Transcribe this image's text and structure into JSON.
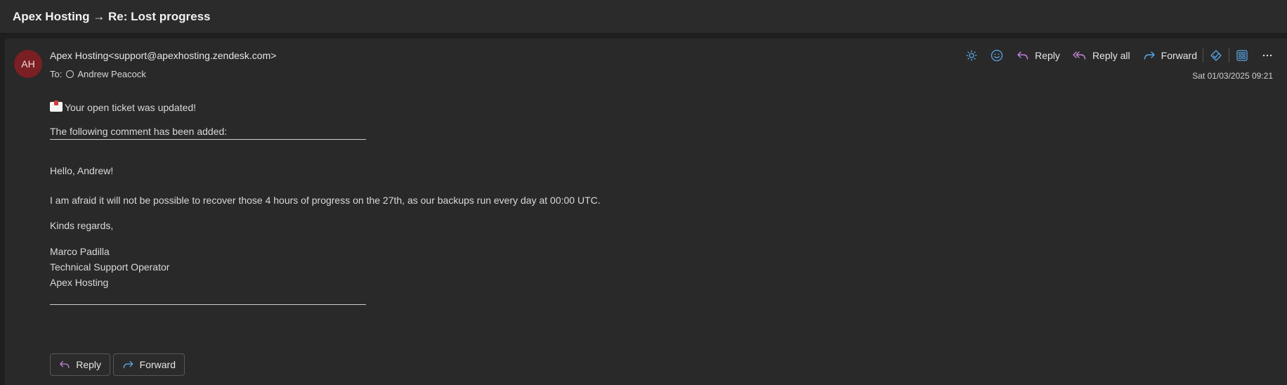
{
  "header": {
    "subject": "Apex Hosting → Re: Lost progress"
  },
  "message": {
    "avatar_initials": "AH",
    "avatar_color": "#7a1f23",
    "sender_name": "Apex Hosting",
    "sender_email": "<support@apexhosting.zendesk.com>",
    "to_label": "To:",
    "recipient": "Andrew Peacock",
    "date": "Sat 01/03/2025 09:21"
  },
  "toolbar": {
    "icons": [
      "sun-icon",
      "emoji-icon"
    ],
    "reply_label": "Reply",
    "reply_all_label": "Reply all",
    "forward_label": "Forward",
    "extra_icons": [
      "immersive-reader-icon",
      "apps-icon",
      "more-icon"
    ]
  },
  "body": {
    "intro": "Your open ticket was updated!",
    "comment_heading": "The following comment has been added:",
    "greeting": "Hello, Andrew!",
    "paragraph": "I am afraid it will not be possible to recover those 4 hours of progress on the 27th, as our backups run every day at 00:00 UTC.",
    "closing": "Kinds regards,",
    "signature_name": "Marco Padilla",
    "signature_title": "Technical Support Operator",
    "signature_company": "Apex Hosting"
  },
  "footer_buttons": {
    "reply_label": "Reply",
    "forward_label": "Forward"
  },
  "colors": {
    "reply_accent": "#c084d8",
    "forward_accent": "#5aa7e6",
    "avatar": "#7a1f23"
  }
}
